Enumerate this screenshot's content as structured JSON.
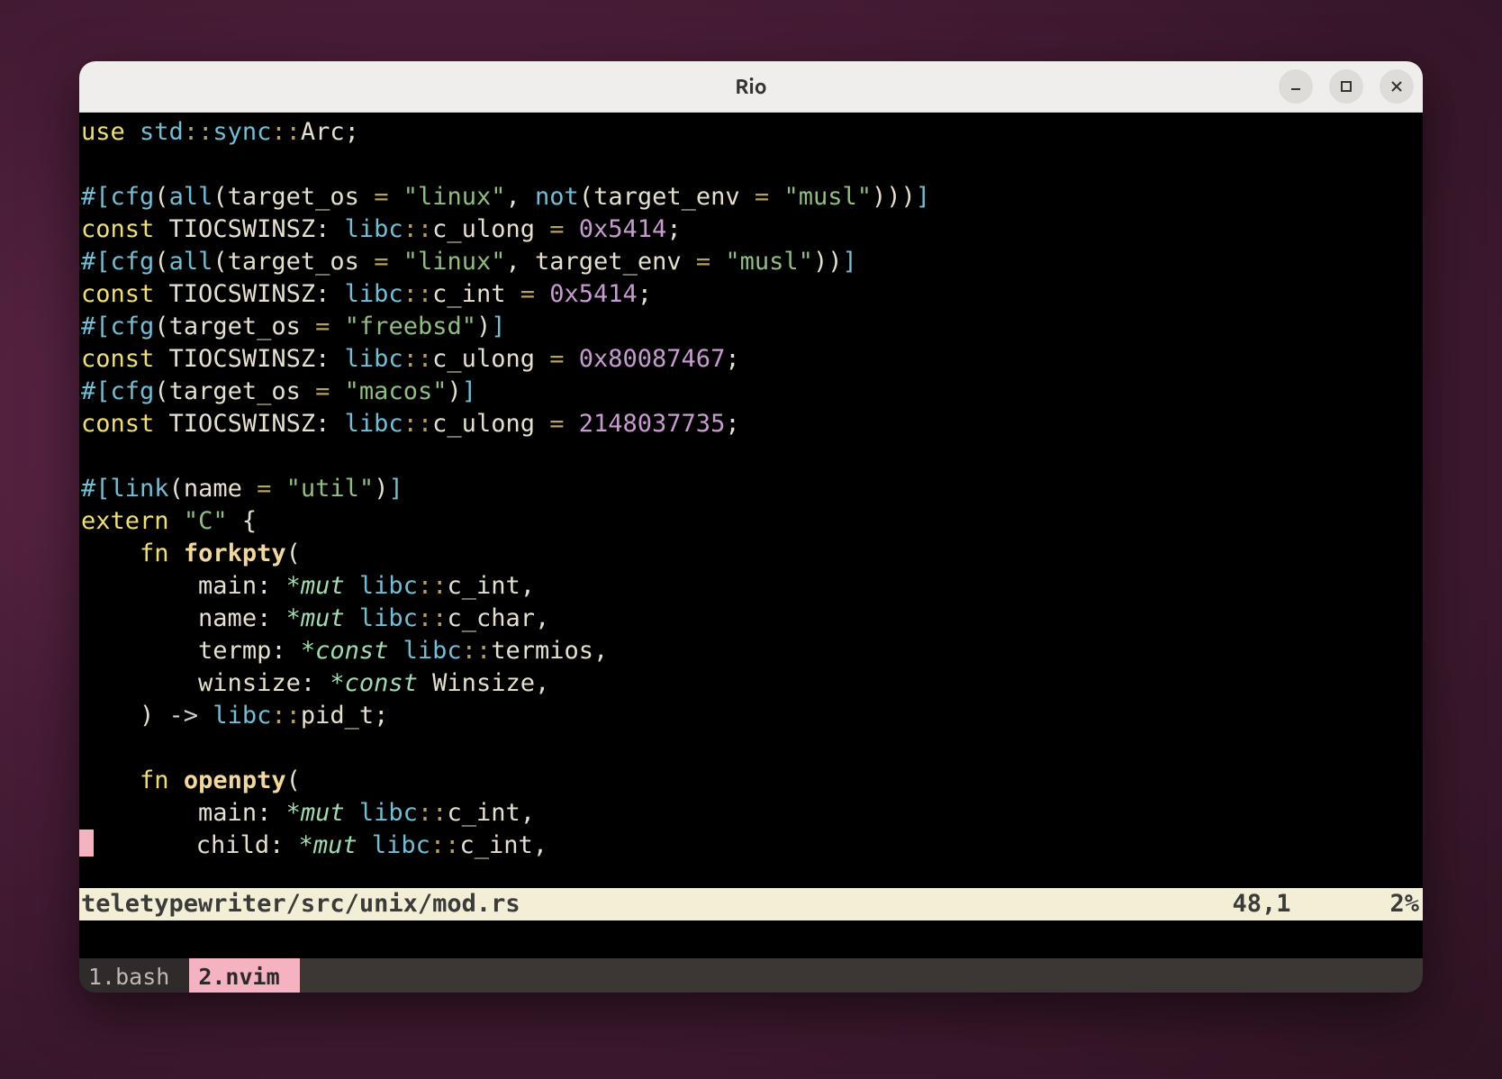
{
  "window": {
    "title": "Rio"
  },
  "status": {
    "file": "teletypewriter/src/unix/mod.rs",
    "cursor": "48,1",
    "percent": "2%"
  },
  "tabs": [
    {
      "label": "1.bash",
      "active": false
    },
    {
      "label": "2.nvim",
      "active": true
    }
  ],
  "code": [
    [
      [
        "kw",
        "use"
      ],
      [
        "pun",
        " "
      ],
      [
        "mod",
        "std"
      ],
      [
        "op",
        "::"
      ],
      [
        "mod",
        "sync"
      ],
      [
        "op",
        "::"
      ],
      [
        "id",
        "Arc"
      ],
      [
        "pun",
        ";"
      ]
    ],
    [],
    [
      [
        "attr",
        "#["
      ],
      [
        "attr",
        "cfg"
      ],
      [
        "pun",
        "("
      ],
      [
        "attr",
        "all"
      ],
      [
        "pun",
        "("
      ],
      [
        "id",
        "target_os"
      ],
      [
        "pun",
        " "
      ],
      [
        "op",
        "="
      ],
      [
        "pun",
        " "
      ],
      [
        "str",
        "\"linux\""
      ],
      [
        "pun",
        ", "
      ],
      [
        "attr",
        "not"
      ],
      [
        "pun",
        "("
      ],
      [
        "id",
        "target_env"
      ],
      [
        "pun",
        " "
      ],
      [
        "op",
        "="
      ],
      [
        "pun",
        " "
      ],
      [
        "str",
        "\"musl\""
      ],
      [
        "pun",
        ")))"
      ],
      [
        "attr",
        "]"
      ]
    ],
    [
      [
        "kw",
        "const"
      ],
      [
        "pun",
        " "
      ],
      [
        "id",
        "TIOCSWINSZ"
      ],
      [
        "pun",
        ": "
      ],
      [
        "mod",
        "libc"
      ],
      [
        "op",
        "::"
      ],
      [
        "ty",
        "c_ulong"
      ],
      [
        "pun",
        " "
      ],
      [
        "op",
        "="
      ],
      [
        "pun",
        " "
      ],
      [
        "num",
        "0x5414"
      ],
      [
        "pun",
        ";"
      ]
    ],
    [
      [
        "attr",
        "#["
      ],
      [
        "attr",
        "cfg"
      ],
      [
        "pun",
        "("
      ],
      [
        "attr",
        "all"
      ],
      [
        "pun",
        "("
      ],
      [
        "id",
        "target_os"
      ],
      [
        "pun",
        " "
      ],
      [
        "op",
        "="
      ],
      [
        "pun",
        " "
      ],
      [
        "str",
        "\"linux\""
      ],
      [
        "pun",
        ", "
      ],
      [
        "id",
        "target_env"
      ],
      [
        "pun",
        " "
      ],
      [
        "op",
        "="
      ],
      [
        "pun",
        " "
      ],
      [
        "str",
        "\"musl\""
      ],
      [
        "pun",
        "))"
      ],
      [
        "attr",
        "]"
      ]
    ],
    [
      [
        "kw",
        "const"
      ],
      [
        "pun",
        " "
      ],
      [
        "id",
        "TIOCSWINSZ"
      ],
      [
        "pun",
        ": "
      ],
      [
        "mod",
        "libc"
      ],
      [
        "op",
        "::"
      ],
      [
        "ty",
        "c_int"
      ],
      [
        "pun",
        " "
      ],
      [
        "op",
        "="
      ],
      [
        "pun",
        " "
      ],
      [
        "num",
        "0x5414"
      ],
      [
        "pun",
        ";"
      ]
    ],
    [
      [
        "attr",
        "#["
      ],
      [
        "attr",
        "cfg"
      ],
      [
        "pun",
        "("
      ],
      [
        "id",
        "target_os"
      ],
      [
        "pun",
        " "
      ],
      [
        "op",
        "="
      ],
      [
        "pun",
        " "
      ],
      [
        "str",
        "\"freebsd\""
      ],
      [
        "pun",
        ")"
      ],
      [
        "attr",
        "]"
      ]
    ],
    [
      [
        "kw",
        "const"
      ],
      [
        "pun",
        " "
      ],
      [
        "id",
        "TIOCSWINSZ"
      ],
      [
        "pun",
        ": "
      ],
      [
        "mod",
        "libc"
      ],
      [
        "op",
        "::"
      ],
      [
        "ty",
        "c_ulong"
      ],
      [
        "pun",
        " "
      ],
      [
        "op",
        "="
      ],
      [
        "pun",
        " "
      ],
      [
        "num",
        "0x80087467"
      ],
      [
        "pun",
        ";"
      ]
    ],
    [
      [
        "attr",
        "#["
      ],
      [
        "attr",
        "cfg"
      ],
      [
        "pun",
        "("
      ],
      [
        "id",
        "target_os"
      ],
      [
        "pun",
        " "
      ],
      [
        "op",
        "="
      ],
      [
        "pun",
        " "
      ],
      [
        "str",
        "\"macos\""
      ],
      [
        "pun",
        ")"
      ],
      [
        "attr",
        "]"
      ]
    ],
    [
      [
        "kw",
        "const"
      ],
      [
        "pun",
        " "
      ],
      [
        "id",
        "TIOCSWINSZ"
      ],
      [
        "pun",
        ": "
      ],
      [
        "mod",
        "libc"
      ],
      [
        "op",
        "::"
      ],
      [
        "ty",
        "c_ulong"
      ],
      [
        "pun",
        " "
      ],
      [
        "op",
        "="
      ],
      [
        "pun",
        " "
      ],
      [
        "num",
        "2148037735"
      ],
      [
        "pun",
        ";"
      ]
    ],
    [],
    [
      [
        "attr",
        "#["
      ],
      [
        "attr",
        "link"
      ],
      [
        "pun",
        "("
      ],
      [
        "id",
        "name"
      ],
      [
        "pun",
        " "
      ],
      [
        "op",
        "="
      ],
      [
        "pun",
        " "
      ],
      [
        "str",
        "\"util\""
      ],
      [
        "pun",
        ")"
      ],
      [
        "attr",
        "]"
      ]
    ],
    [
      [
        "kw",
        "extern"
      ],
      [
        "pun",
        " "
      ],
      [
        "str",
        "\"C\""
      ],
      [
        "pun",
        " {"
      ]
    ],
    [
      [
        "pun",
        "    "
      ],
      [
        "kw",
        "fn"
      ],
      [
        "pun",
        " "
      ],
      [
        "fnn",
        "forkpty"
      ],
      [
        "pun",
        "("
      ]
    ],
    [
      [
        "pun",
        "        "
      ],
      [
        "id",
        "main"
      ],
      [
        "pun",
        ": "
      ],
      [
        "ptr",
        "*mut"
      ],
      [
        "pun",
        " "
      ],
      [
        "mod",
        "libc"
      ],
      [
        "op",
        "::"
      ],
      [
        "ty",
        "c_int"
      ],
      [
        "pun",
        ","
      ]
    ],
    [
      [
        "pun",
        "        "
      ],
      [
        "id",
        "name"
      ],
      [
        "pun",
        ": "
      ],
      [
        "ptr",
        "*mut"
      ],
      [
        "pun",
        " "
      ],
      [
        "mod",
        "libc"
      ],
      [
        "op",
        "::"
      ],
      [
        "ty",
        "c_char"
      ],
      [
        "pun",
        ","
      ]
    ],
    [
      [
        "pun",
        "        "
      ],
      [
        "id",
        "termp"
      ],
      [
        "pun",
        ": "
      ],
      [
        "ptr",
        "*const"
      ],
      [
        "pun",
        " "
      ],
      [
        "mod",
        "libc"
      ],
      [
        "op",
        "::"
      ],
      [
        "ty",
        "termios"
      ],
      [
        "pun",
        ","
      ]
    ],
    [
      [
        "pun",
        "        "
      ],
      [
        "id",
        "winsize"
      ],
      [
        "pun",
        ": "
      ],
      [
        "ptr",
        "*const"
      ],
      [
        "pun",
        " "
      ],
      [
        "ty",
        "Winsize"
      ],
      [
        "pun",
        ","
      ]
    ],
    [
      [
        "pun",
        "    ) "
      ],
      [
        "arr",
        "->"
      ],
      [
        "pun",
        " "
      ],
      [
        "mod",
        "libc"
      ],
      [
        "op",
        "::"
      ],
      [
        "ty",
        "pid_t"
      ],
      [
        "pun",
        ";"
      ]
    ],
    [],
    [
      [
        "pun",
        "    "
      ],
      [
        "kw",
        "fn"
      ],
      [
        "pun",
        " "
      ],
      [
        "fnn",
        "openpty"
      ],
      [
        "pun",
        "("
      ]
    ],
    [
      [
        "pun",
        "        "
      ],
      [
        "id",
        "main"
      ],
      [
        "pun",
        ": "
      ],
      [
        "ptr",
        "*mut"
      ],
      [
        "pun",
        " "
      ],
      [
        "mod",
        "libc"
      ],
      [
        "op",
        "::"
      ],
      [
        "ty",
        "c_int"
      ],
      [
        "pun",
        ","
      ]
    ],
    [
      [
        "cursor",
        ""
      ],
      [
        "pun",
        "       "
      ],
      [
        "id",
        "child"
      ],
      [
        "pun",
        ": "
      ],
      [
        "ptr",
        "*mut"
      ],
      [
        "pun",
        " "
      ],
      [
        "mod",
        "libc"
      ],
      [
        "op",
        "::"
      ],
      [
        "ty",
        "c_int"
      ],
      [
        "pun",
        ","
      ]
    ]
  ]
}
